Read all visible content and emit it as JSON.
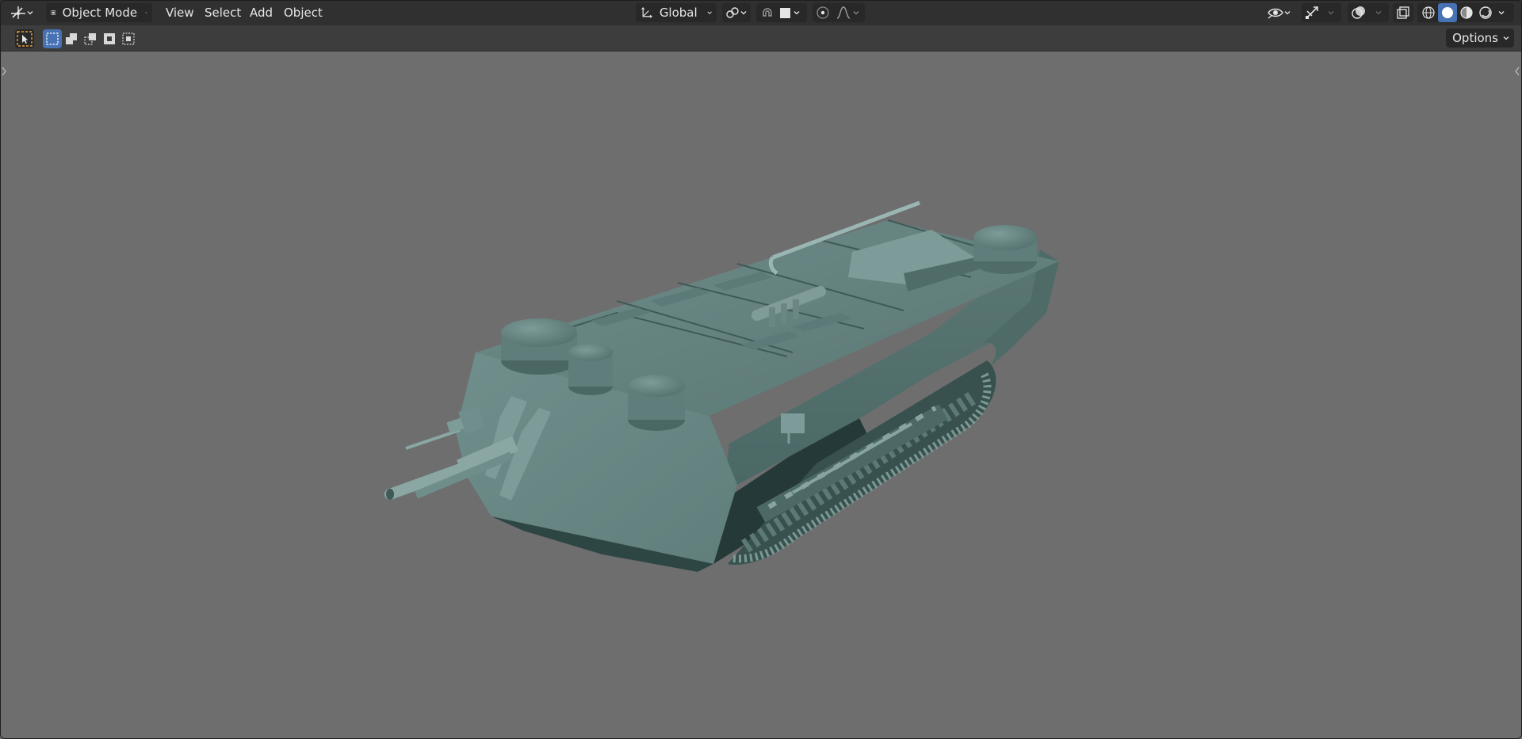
{
  "header": {
    "mode_label": "Object Mode",
    "menus": [
      "View",
      "Select",
      "Add",
      "Object"
    ],
    "orientation_label": "Global"
  },
  "toolbar": {
    "options_label": "Options"
  },
  "viewport": {
    "background": "#6e6e6e",
    "model": "tank",
    "model_color": "#5e7b78"
  },
  "icons": {
    "editor_type": "object-transform-icon",
    "mode": "object-mode-icon",
    "orientation": "transform-orientation-icon",
    "pivot": "pivot-point-icon",
    "snap": "snap-magnet-icon",
    "proportional": "proportional-edit-icon",
    "falloff": "falloff-curve-icon",
    "visibility": "eye-icon",
    "gizmo": "gizmo-icon",
    "overlay": "overlay-icon",
    "xray": "xray-icon",
    "shading_wireframe": "wireframe-sphere-icon",
    "shading_solid": "solid-sphere-icon",
    "shading_material": "material-sphere-icon",
    "shading_rendered": "rendered-sphere-icon"
  }
}
